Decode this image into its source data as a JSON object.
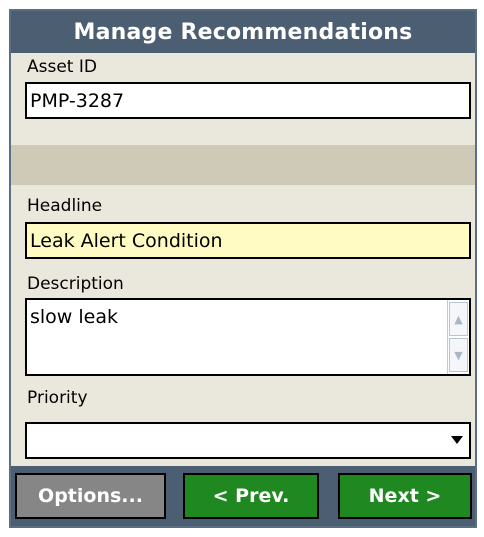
{
  "window": {
    "title": "Manage Recommendations"
  },
  "fields": {
    "asset_id": {
      "label": "Asset ID",
      "value": "PMP-3287"
    },
    "headline": {
      "label": "Headline",
      "value": "Leak Alert Condition"
    },
    "description": {
      "label": "Description",
      "value": "slow leak"
    },
    "priority": {
      "label": "Priority",
      "value": ""
    }
  },
  "icons": {
    "scroll_up": "scroll-up-icon",
    "scroll_down": "scroll-down-icon",
    "dropdown": "chevron-down-icon"
  },
  "buttons": {
    "options": "Options...",
    "prev": "< Prev.",
    "next": "Next >"
  },
  "colors": {
    "title_bar": "#4b5e72",
    "headline_highlight": "#fffbc2",
    "nav_button": "#208820",
    "options_button": "#868686"
  }
}
